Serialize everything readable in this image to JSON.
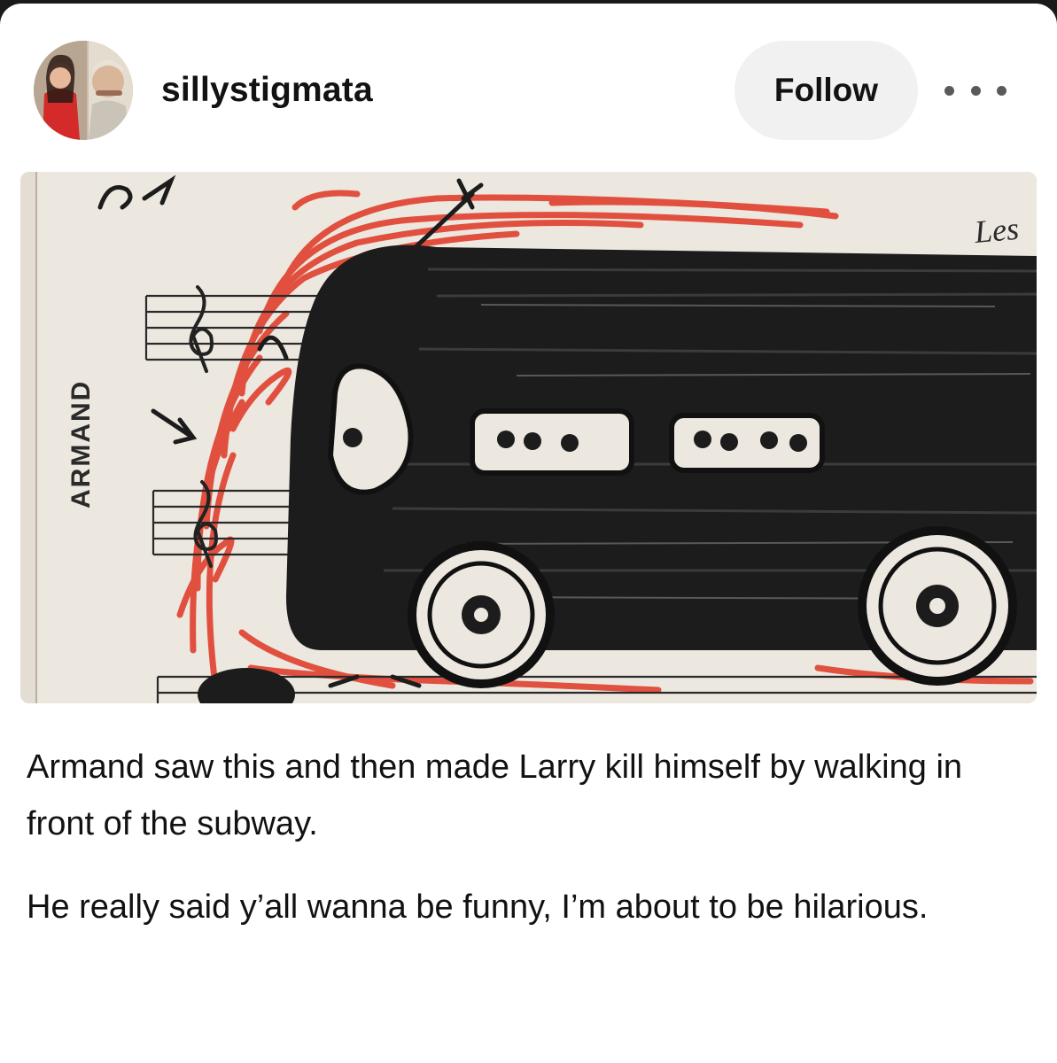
{
  "post": {
    "username": "sillystigmata",
    "follow_label": "Follow",
    "more_icon": "more-horizontal-icon",
    "image": {
      "handwritten_labels": [
        "ARMAND",
        "Les"
      ]
    },
    "caption": [
      "Armand saw this and then made Larry kill himself by walking in front of the subway.",
      "He really said y’all wanna be funny, I’m about to be hilarious."
    ]
  },
  "colors": {
    "follow_bg": "#f1f1f2",
    "text": "#121212",
    "marker_red": "#e0402e",
    "marker_black": "#1c1c1c"
  }
}
